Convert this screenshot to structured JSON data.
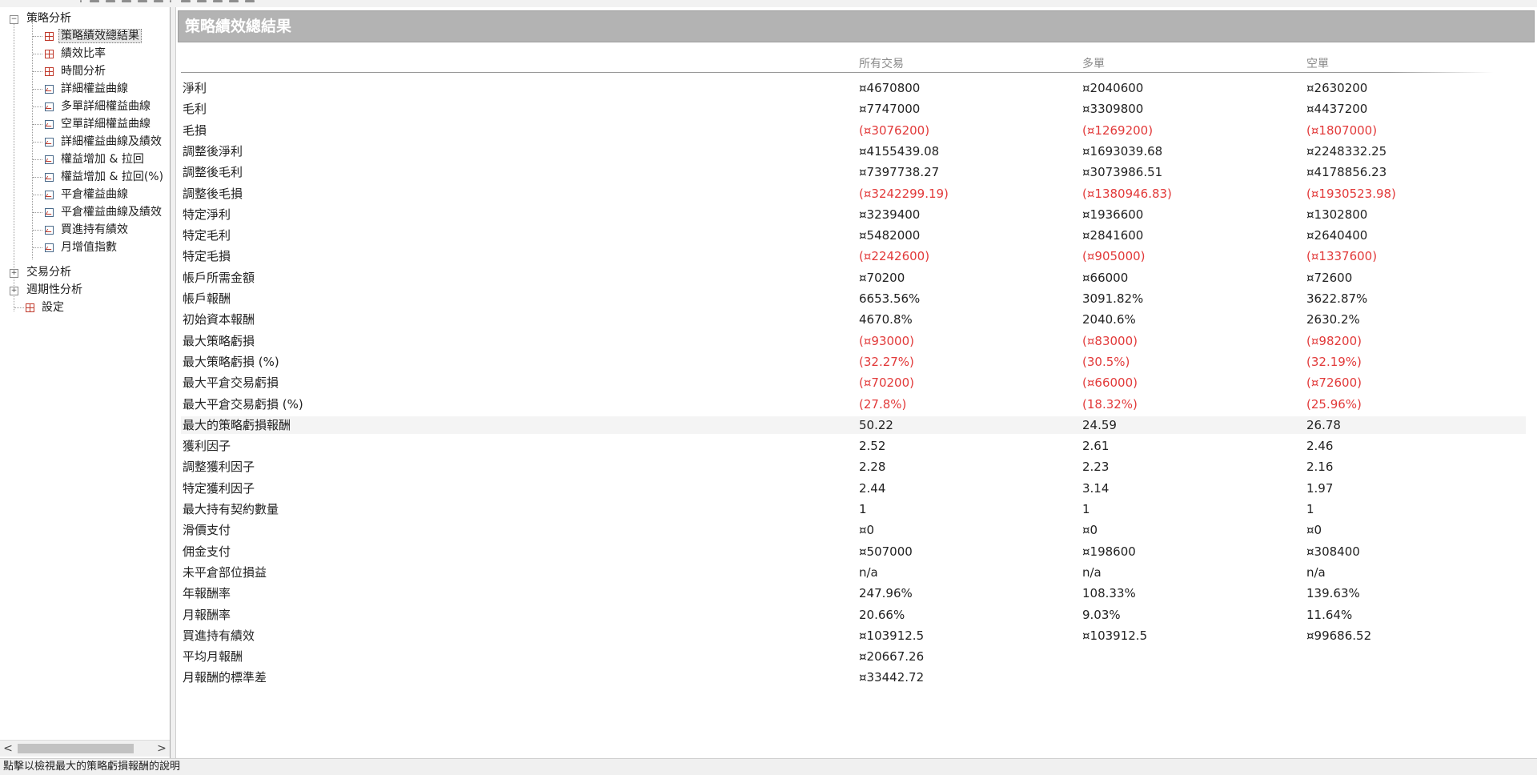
{
  "tree": {
    "root": {
      "label": "策略分析",
      "expander": "−"
    },
    "children": [
      {
        "label": "策略績效總結果",
        "icon": "grid-icon",
        "selected": true
      },
      {
        "label": "績效比率",
        "icon": "grid-icon"
      },
      {
        "label": "時間分析",
        "icon": "grid-icon"
      },
      {
        "label": "詳細權益曲線",
        "icon": "chart-icon"
      },
      {
        "label": "多單詳細權益曲線",
        "icon": "chart-icon"
      },
      {
        "label": "空單詳細權益曲線",
        "icon": "chart-icon"
      },
      {
        "label": "詳細權益曲線及績效",
        "icon": "chart-icon"
      },
      {
        "label": "權益增加 & 拉回",
        "icon": "chart-icon"
      },
      {
        "label": "權益增加 & 拉回(%)",
        "icon": "chart-icon"
      },
      {
        "label": "平倉權益曲線",
        "icon": "chart-icon"
      },
      {
        "label": "平倉權益曲線及績效",
        "icon": "chart-icon"
      },
      {
        "label": "買進持有績效",
        "icon": "chart-icon"
      },
      {
        "label": "月增值指數",
        "icon": "chart-icon"
      }
    ],
    "others": [
      {
        "label": "交易分析",
        "expander": "+"
      },
      {
        "label": "週期性分析",
        "expander": "+"
      },
      {
        "label": "設定",
        "icon": "grid-icon"
      }
    ],
    "scroll_left": "<",
    "scroll_right": ">"
  },
  "report": {
    "title": "策略績效總結果",
    "columns": [
      "所有交易",
      "多單",
      "空單"
    ],
    "rows": [
      {
        "label": "淨利",
        "values": [
          "¤4670800",
          "¤2040600",
          "¤2630200"
        ]
      },
      {
        "label": "毛利",
        "values": [
          "¤7747000",
          "¤3309800",
          "¤4437200"
        ]
      },
      {
        "label": "毛損",
        "values": [
          "(¤3076200)",
          "(¤1269200)",
          "(¤1807000)"
        ],
        "negative": true
      },
      {
        "label": "調整後淨利",
        "values": [
          "¤4155439.08",
          "¤1693039.68",
          "¤2248332.25"
        ]
      },
      {
        "label": "調整後毛利",
        "values": [
          "¤7397738.27",
          "¤3073986.51",
          "¤4178856.23"
        ]
      },
      {
        "label": "調整後毛損",
        "values": [
          "(¤3242299.19)",
          "(¤1380946.83)",
          "(¤1930523.98)"
        ],
        "negative": true
      },
      {
        "label": "特定淨利",
        "values": [
          "¤3239400",
          "¤1936600",
          "¤1302800"
        ]
      },
      {
        "label": "特定毛利",
        "values": [
          "¤5482000",
          "¤2841600",
          "¤2640400"
        ]
      },
      {
        "label": "特定毛損",
        "values": [
          "(¤2242600)",
          "(¤905000)",
          "(¤1337600)"
        ],
        "negative": true
      },
      {
        "label": "帳戶所需金額",
        "values": [
          "¤70200",
          "¤66000",
          "¤72600"
        ]
      },
      {
        "label": "帳戶報酬",
        "values": [
          "6653.56%",
          "3091.82%",
          "3622.87%"
        ]
      },
      {
        "label": "初始資本報酬",
        "values": [
          "4670.8%",
          "2040.6%",
          "2630.2%"
        ]
      },
      {
        "label": "最大策略虧損",
        "values": [
          "(¤93000)",
          "(¤83000)",
          "(¤98200)"
        ],
        "negative": true
      },
      {
        "label": "最大策略虧損 (%)",
        "values": [
          "(32.27%)",
          "(30.5%)",
          "(32.19%)"
        ],
        "negative": true
      },
      {
        "label": "最大平倉交易虧損",
        "values": [
          "(¤70200)",
          "(¤66000)",
          "(¤72600)"
        ],
        "negative": true
      },
      {
        "label": "最大平倉交易虧損 (%)",
        "values": [
          "(27.8%)",
          "(18.32%)",
          "(25.96%)"
        ],
        "negative": true
      },
      {
        "label": "最大的策略虧損報酬",
        "values": [
          "50.22",
          "24.59",
          "26.78"
        ],
        "highlighted": true
      },
      {
        "label": "獲利因子",
        "values": [
          "2.52",
          "2.61",
          "2.46"
        ]
      },
      {
        "label": "調整獲利因子",
        "values": [
          "2.28",
          "2.23",
          "2.16"
        ]
      },
      {
        "label": "特定獲利因子",
        "values": [
          "2.44",
          "3.14",
          "1.97"
        ]
      },
      {
        "label": "最大持有契約數量",
        "values": [
          "1",
          "1",
          "1"
        ]
      },
      {
        "label": "滑價支付",
        "values": [
          "¤0",
          "¤0",
          "¤0"
        ]
      },
      {
        "label": "佣金支付",
        "values": [
          "¤507000",
          "¤198600",
          "¤308400"
        ]
      },
      {
        "label": "未平倉部位損益",
        "values": [
          "n/a",
          "n/a",
          "n/a"
        ]
      },
      {
        "label": "年報酬率",
        "values": [
          "247.96%",
          "108.33%",
          "139.63%"
        ]
      },
      {
        "label": "月報酬率",
        "values": [
          "20.66%",
          "9.03%",
          "11.64%"
        ]
      },
      {
        "label": "買進持有績效",
        "values": [
          "¤103912.5",
          "¤103912.5",
          "¤99686.52"
        ]
      },
      {
        "label": "平均月報酬",
        "values": [
          "¤20667.26",
          "",
          ""
        ]
      },
      {
        "label": "月報酬的標準差",
        "values": [
          "¤33442.72",
          "",
          ""
        ]
      }
    ]
  },
  "status": {
    "text": "點擊以檢視最大的策略虧損報酬的說明"
  },
  "colors": {
    "negative": "#e23a3a",
    "title_bar": "#b3b3b3",
    "header_text": "#8a8a8a"
  }
}
